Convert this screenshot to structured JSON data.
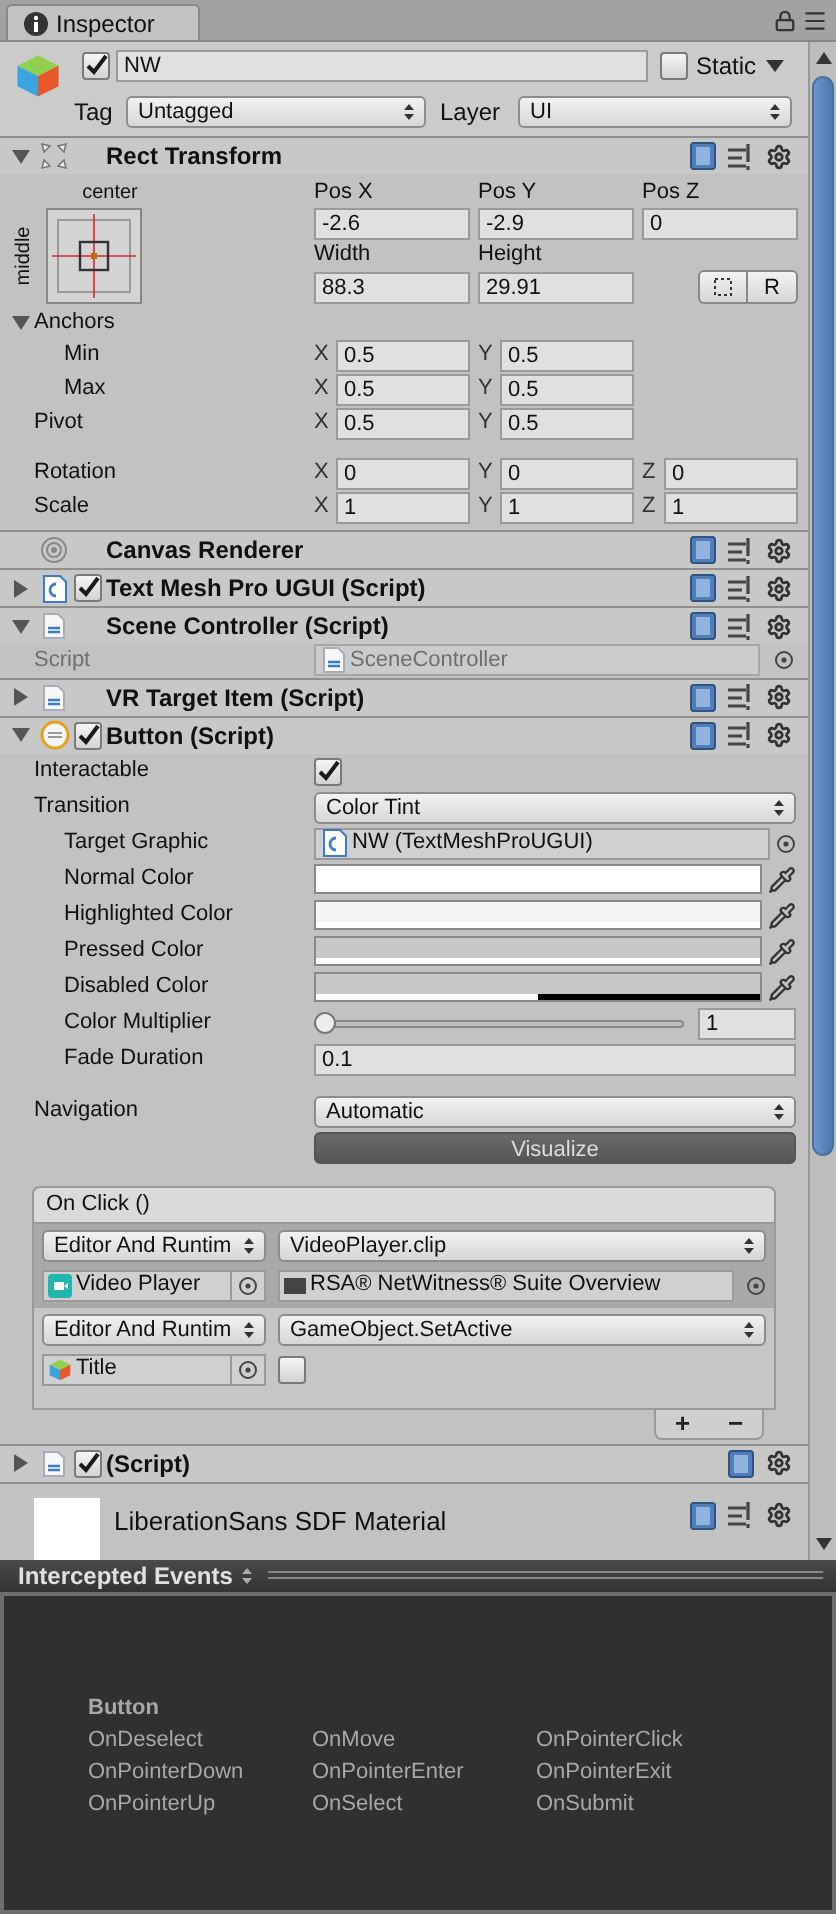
{
  "tab": {
    "label": "Inspector"
  },
  "object": {
    "active": true,
    "name": "NW",
    "static": false,
    "static_label": "Static",
    "tag_label": "Tag",
    "tag": "Untagged",
    "layer_label": "Layer",
    "layer": "UI"
  },
  "components": [
    {
      "kind": "rect",
      "title": "Rect Transform",
      "expanded": true,
      "presets": true,
      "anchor_h": "center",
      "anchor_v": "middle",
      "fields": [
        {
          "label": "Pos X",
          "value": "-2.6"
        },
        {
          "label": "Pos Y",
          "value": "-2.9"
        },
        {
          "label": "Pos Z",
          "value": "0"
        },
        {
          "label": "Width",
          "value": "88.3"
        },
        {
          "label": "Height",
          "value": "29.91"
        }
      ],
      "raw_label": "R",
      "anchors": {
        "label": "Anchors",
        "expanded": true,
        "children": [
          {
            "label": "Min",
            "axes": [
              {
                "axis": "X",
                "value": "0.5"
              },
              {
                "axis": "Y",
                "value": "0.5"
              }
            ]
          },
          {
            "label": "Max",
            "axes": [
              {
                "axis": "X",
                "value": "0.5"
              },
              {
                "axis": "Y",
                "value": "0.5"
              }
            ]
          }
        ]
      },
      "rows": [
        {
          "label": "Pivot",
          "axes": [
            {
              "axis": "X",
              "value": "0.5"
            },
            {
              "axis": "Y",
              "value": "0.5"
            }
          ]
        },
        {
          "label": "Rotation",
          "axes": [
            {
              "axis": "X",
              "value": "0"
            },
            {
              "axis": "Y",
              "value": "0"
            },
            {
              "axis": "Z",
              "value": "0"
            }
          ]
        },
        {
          "label": "Scale",
          "axes": [
            {
              "axis": "X",
              "value": "1"
            },
            {
              "axis": "Y",
              "value": "1"
            },
            {
              "axis": "Z",
              "value": "1"
            }
          ]
        }
      ]
    },
    {
      "kind": "renderer",
      "title": "Canvas Renderer",
      "presets": true
    },
    {
      "kind": "tmp",
      "title": "Text Mesh Pro UGUI (Script)",
      "expanded": false,
      "enabled": true,
      "presets": true
    },
    {
      "kind": "script",
      "title": "Scene Controller (Script)",
      "expanded": true,
      "presets": true,
      "fields": [
        {
          "label": "Script",
          "value": "SceneController",
          "disabled": true
        }
      ]
    },
    {
      "kind": "script",
      "title": "VR Target Item (Script)",
      "expanded": false,
      "presets": true
    },
    {
      "kind": "button",
      "title": "Button (Script)",
      "expanded": true,
      "enabled": true,
      "presets": true,
      "interactable": {
        "label": "Interactable",
        "checked": true
      },
      "transition": {
        "label": "Transition",
        "value": "Color Tint"
      },
      "target_graphic": {
        "label": "Target Graphic",
        "value": "NW (TextMeshProUGUI)"
      },
      "colors": [
        {
          "label": "Normal Color",
          "color": "#ffffff",
          "level": 1
        },
        {
          "label": "Highlighted Color",
          "color": "#f5f5f5",
          "level": 1
        },
        {
          "label": "Pressed Color",
          "color": "#c8c8c8",
          "level": 1
        },
        {
          "label": "Disabled Color",
          "color": "#c8c8c8",
          "level": 0.5
        }
      ],
      "multiplier": {
        "label": "Color Multiplier",
        "level": 0,
        "value": "1"
      },
      "fade": {
        "label": "Fade Duration",
        "value": "0.1"
      },
      "navigation": {
        "label": "Navigation",
        "value": "Automatic"
      },
      "visualize": {
        "label": "Visualize",
        "selected": false
      },
      "on_click": {
        "title": "On Click ()",
        "add": "+",
        "remove": "−",
        "entries": [
          {
            "kind": "object",
            "selected": true,
            "mode": "Editor And Runtim",
            "function": "VideoPlayer.clip",
            "target": "Video Player",
            "argument": "RSA® NetWitness® Suite Overview"
          },
          {
            "kind": "bool",
            "selected": false,
            "mode": "Editor And Runtim",
            "function": "GameObject.SetActive",
            "target": "Title",
            "checked": false
          }
        ]
      }
    },
    {
      "kind": "script",
      "title": "(Script)",
      "expanded": false,
      "enabled": true,
      "presets": false
    },
    {
      "kind": "material",
      "title": "LiberationSans SDF Material",
      "presets": true
    }
  ],
  "events": {
    "title": "Intercepted Events",
    "group": "Button",
    "items": [
      "OnDeselect",
      "OnMove",
      "OnPointerClick",
      "OnPointerDown",
      "OnPointerEnter",
      "OnPointerExit",
      "OnPointerUp",
      "OnSelect",
      "OnSubmit"
    ]
  }
}
